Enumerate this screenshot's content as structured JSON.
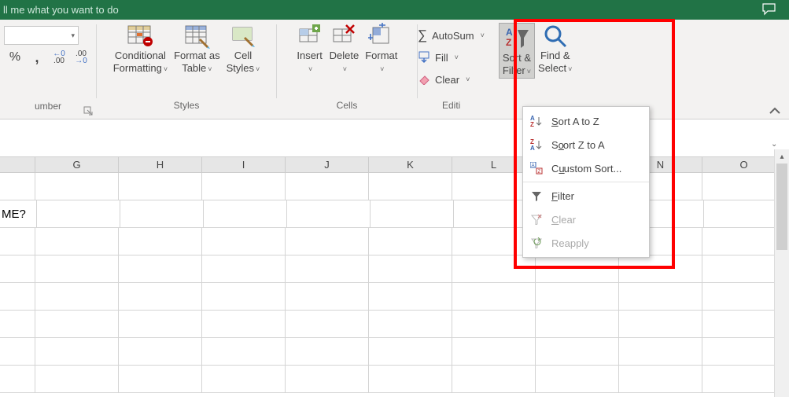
{
  "titlebar": {
    "tell_me": "ll me what you want to do"
  },
  "number_group": {
    "label": "umber",
    "percent": "%",
    "comma": ",",
    "inc_dec_a": ".0",
    "inc_dec_b": ".00"
  },
  "styles_group": {
    "label": "Styles",
    "conditional": "Conditional",
    "formatting": "Formatting",
    "format_as": "Format as",
    "table": "Table",
    "cell": "Cell",
    "styles": "Styles"
  },
  "cells_group": {
    "label": "Cells",
    "insert": "Insert",
    "delete": "Delete",
    "format": "Format"
  },
  "editing_group": {
    "label": "Editing",
    "autosum": "AutoSum",
    "fill": "Fill",
    "clear": "Clear",
    "sort_filter_l1": "Sort &",
    "sort_filter_l2": "Filter",
    "find_select_l1": "Find &",
    "find_select_l2": "Select"
  },
  "sort_menu": {
    "sort_az": "ort A to Z",
    "sort_za": "ort Z to A",
    "custom": "ustom Sort...",
    "filter": "ilter",
    "clear": "lear",
    "reapply": "Reapply"
  },
  "columns": [
    "G",
    "H",
    "I",
    "J",
    "K",
    "L",
    "",
    "N",
    "O"
  ],
  "cell_a2_text": "ME?",
  "colors": {
    "brand": "#217346",
    "highlight": "#ff0000"
  }
}
